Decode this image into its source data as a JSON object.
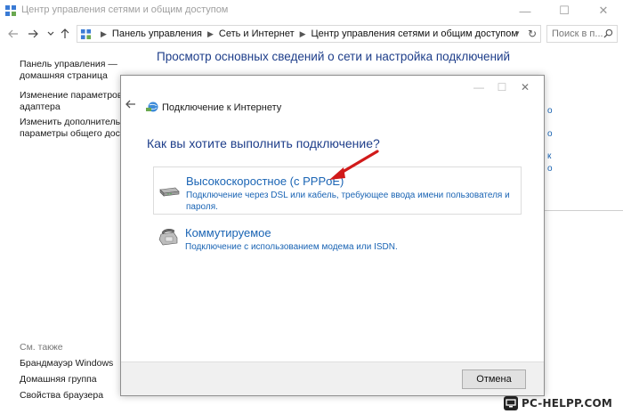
{
  "window": {
    "title": "Центр управления сетями и общим доступом",
    "controls": {
      "minimize": "—",
      "maximize": "☐",
      "close": "✕"
    }
  },
  "addressbar": {
    "breadcrumbs": [
      "Панель управления",
      "Сеть и Интернет",
      "Центр управления сетями и общим доступом"
    ],
    "search_placeholder": "Поиск в п..."
  },
  "sidebar": {
    "items": [
      {
        "label": "Панель управления —\nдомашняя страница"
      },
      {
        "label": "Изменение параметров\nадаптера"
      },
      {
        "label": "Изменить дополнительные\nпараметры общего доступ"
      }
    ],
    "see_also_heading": "См. также",
    "see_also": [
      {
        "label": "Брандмауэр Windows"
      },
      {
        "label": "Домашняя группа"
      },
      {
        "label": "Свойства браузера"
      }
    ]
  },
  "main": {
    "heading": "Просмотр основных сведений о сети и настройка подключений",
    "right_fragments": [
      "о",
      "о",
      "к",
      "о"
    ]
  },
  "dialog": {
    "title": "Подключение к Интернету",
    "question": "Как вы хотите выполнить подключение?",
    "options": [
      {
        "title": "Высокоскоростное (с PPPoE)",
        "description": "Подключение через DSL или кабель, требующее ввода имени пользователя и пароля.",
        "icon": "modem-icon"
      },
      {
        "title": "Коммутируемое",
        "description": "Подключение с использованием модема или ISDN.",
        "icon": "dialup-phone-icon"
      }
    ],
    "cancel_label": "Отмена"
  },
  "watermark": {
    "text": "PC-HELPP.COM"
  },
  "colors": {
    "link_blue": "#1a64b4",
    "heading_blue": "#1e3e8a",
    "arrow_red": "#d11a1a"
  }
}
